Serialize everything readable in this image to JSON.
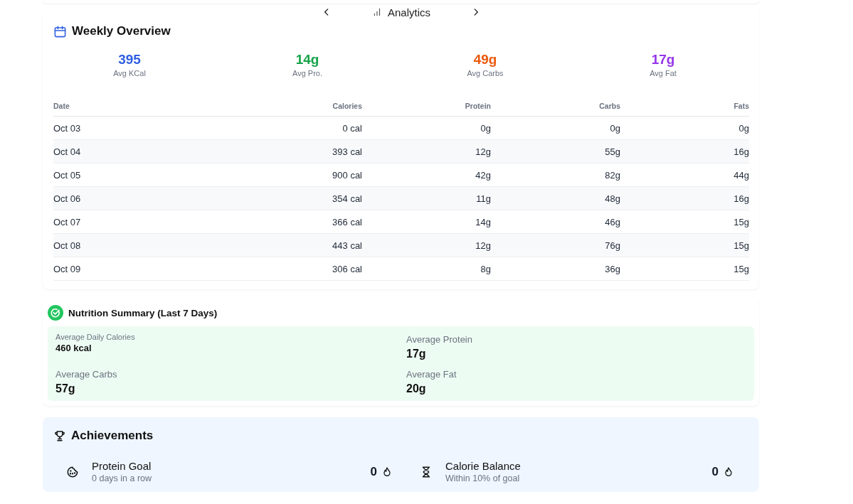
{
  "nav": {
    "title": "Analytics"
  },
  "weekly_overview": {
    "title": "Weekly Overview",
    "stats": [
      {
        "value": "395",
        "label": "Avg KCal",
        "color": "#2f5fe0"
      },
      {
        "value": "14g",
        "label": "Avg Pro.",
        "color": "#16a34a"
      },
      {
        "value": "49g",
        "label": "Avg Carbs",
        "color": "#ea580c"
      },
      {
        "value": "17g",
        "label": "Avg Fat",
        "color": "#9333ea"
      }
    ],
    "table": {
      "columns": [
        "Date",
        "Calories",
        "Protein",
        "Carbs",
        "Fats"
      ],
      "rows": [
        [
          "Oct 03",
          "0 cal",
          "0g",
          "0g",
          "0g"
        ],
        [
          "Oct 04",
          "393 cal",
          "12g",
          "55g",
          "16g"
        ],
        [
          "Oct 05",
          "900 cal",
          "42g",
          "82g",
          "44g"
        ],
        [
          "Oct 06",
          "354 cal",
          "11g",
          "48g",
          "16g"
        ],
        [
          "Oct 07",
          "366 cal",
          "14g",
          "46g",
          "15g"
        ],
        [
          "Oct 08",
          "443 cal",
          "12g",
          "76g",
          "15g"
        ],
        [
          "Oct 09",
          "306 cal",
          "8g",
          "36g",
          "15g"
        ]
      ]
    }
  },
  "nutrition_summary": {
    "title": "Nutrition Summary (Last 7 Days)",
    "items": [
      {
        "kind": "compact",
        "label": "Average Daily Calories",
        "value": "460 kcal"
      },
      {
        "kind": "large",
        "label": "Average Protein",
        "value": "17g"
      },
      {
        "kind": "large",
        "label": "Average Carbs",
        "value": "57g"
      },
      {
        "kind": "large",
        "label": "Average Fat",
        "value": "20g"
      }
    ]
  },
  "achievements": {
    "title": "Achievements",
    "items": [
      {
        "kind": "cookie",
        "title": "Protein Goal",
        "subtitle": "0 days in a row",
        "count": "0"
      },
      {
        "kind": "hourglass",
        "title": "Calorie Balance",
        "subtitle": "Within 10% of goal",
        "count": "0"
      }
    ]
  }
}
